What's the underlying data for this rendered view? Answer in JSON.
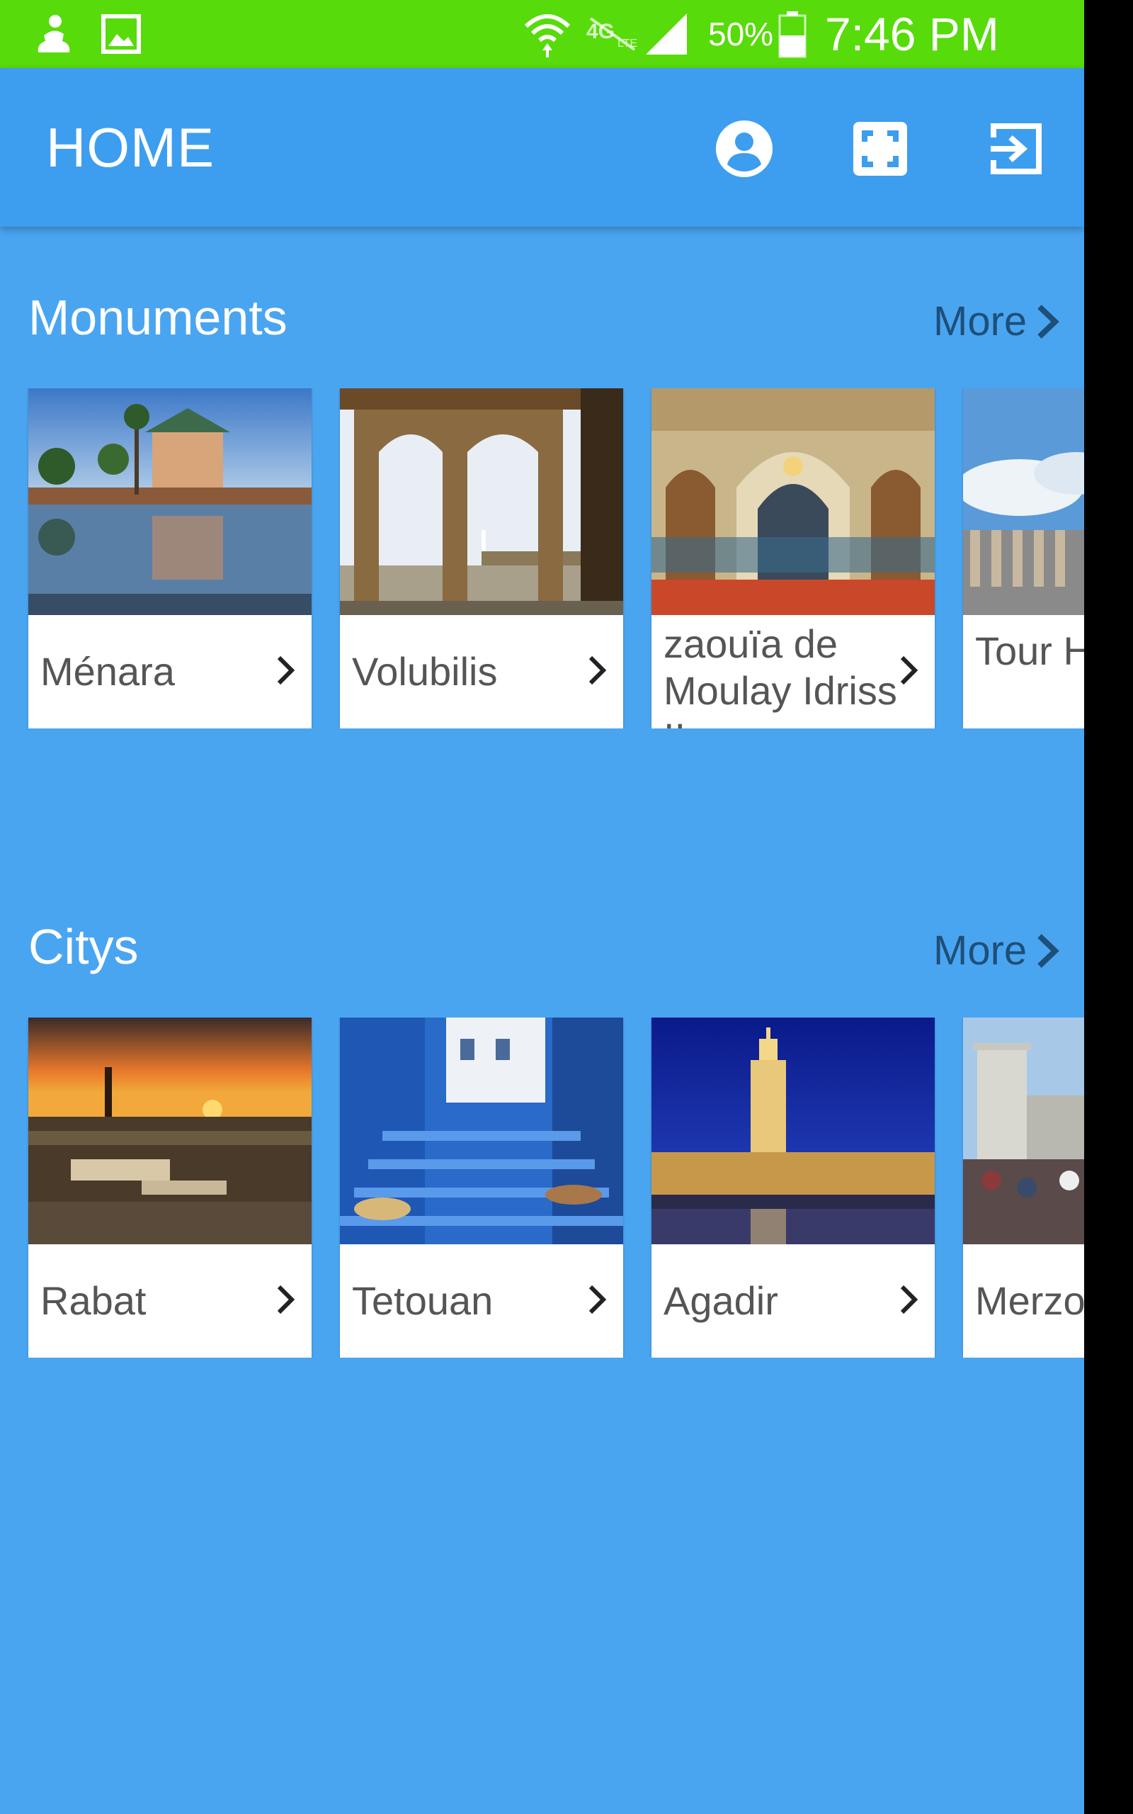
{
  "status_bar": {
    "battery_percent": "50%",
    "time": "7:46 PM",
    "icons": [
      "notification-icon",
      "gallery-icon",
      "wifi-icon",
      "lte-icon",
      "signal-icon",
      "battery-icon"
    ]
  },
  "app_bar": {
    "title": "HOME",
    "actions": [
      "account-circle-icon",
      "fullscreen-icon",
      "exit-to-app-icon"
    ]
  },
  "sections": [
    {
      "title": "Monuments",
      "more_label": "More",
      "cards": [
        {
          "name": "Ménara"
        },
        {
          "name": "Volubilis"
        },
        {
          "name": "zaouïa de Moulay Idriss II"
        },
        {
          "name": "Tour Hassan"
        }
      ]
    },
    {
      "title": "Citys",
      "more_label": "More",
      "cards": [
        {
          "name": "Rabat"
        },
        {
          "name": "Tetouan"
        },
        {
          "name": "Agadir"
        },
        {
          "name": "Merzouga"
        }
      ]
    }
  ],
  "colors": {
    "status_bar": "#57db0a",
    "app_bar": "#3d9eef",
    "background": "#4aa5f1",
    "more_link": "#1d4f79"
  }
}
